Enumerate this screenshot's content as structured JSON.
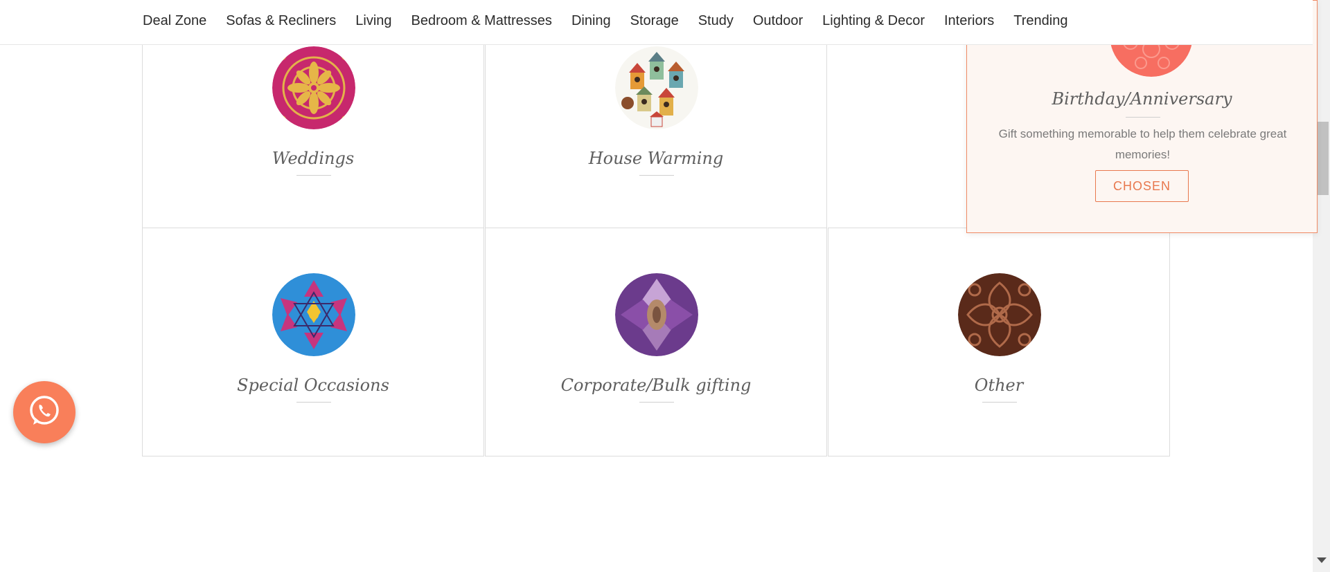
{
  "nav": {
    "items": [
      "Deal Zone",
      "Sofas & Recliners",
      "Living",
      "Bedroom & Mattresses",
      "Dining",
      "Storage",
      "Study",
      "Outdoor",
      "Lighting & Decor",
      "Interiors",
      "Trending"
    ]
  },
  "occasions": [
    {
      "title": "Weddings",
      "icon": "mandala-pink-gold-icon"
    },
    {
      "title": "House Warming",
      "icon": "birdhouses-icon"
    },
    {
      "title": "Birthday/Anniversary",
      "icon": "coral-pattern-icon",
      "description": "Gift something memorable to help them celebrate great memories!",
      "button": "CHOSEN",
      "selected": true
    },
    {
      "title": "Special Occasions",
      "icon": "kaleidoscope-blue-icon"
    },
    {
      "title": "Corporate/Bulk gifting",
      "icon": "purple-kaleidoscope-icon"
    },
    {
      "title": "Other",
      "icon": "brown-damask-icon"
    }
  ],
  "colors": {
    "accent": "#e8774d",
    "selected_bg": "#fdf6f2",
    "whatsapp_button": "#f97f5a"
  },
  "whatsapp": {
    "icon": "whatsapp-icon"
  }
}
